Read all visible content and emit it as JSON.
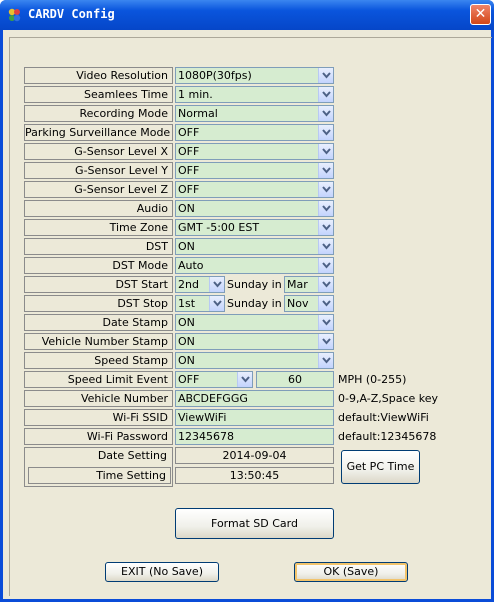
{
  "window": {
    "title": "CARDV Config",
    "close_glyph": "✕"
  },
  "settings": [
    {
      "label": "Video Resolution",
      "value": "1080P(30fps)"
    },
    {
      "label": "Seamlees Time",
      "value": "1 min."
    },
    {
      "label": "Recording Mode",
      "value": "Normal"
    },
    {
      "label": "Parking Surveillance Mode",
      "value": "OFF"
    },
    {
      "label": "G-Sensor Level X",
      "value": "OFF"
    },
    {
      "label": "G-Sensor Level Y",
      "value": "OFF"
    },
    {
      "label": "G-Sensor Level Z",
      "value": "OFF"
    },
    {
      "label": "Audio",
      "value": "ON"
    },
    {
      "label": "Time Zone",
      "value": "GMT -5:00 EST"
    },
    {
      "label": "DST",
      "value": "ON"
    },
    {
      "label": "DST Mode",
      "value": "Auto"
    }
  ],
  "dst_start": {
    "label": "DST Start",
    "week": "2nd",
    "middle": "Sunday in",
    "month": "Mar"
  },
  "dst_stop": {
    "label": "DST Stop",
    "week": "1st",
    "middle": "Sunday in",
    "month": "Nov"
  },
  "stamps": [
    {
      "label": "Date Stamp",
      "value": "ON"
    },
    {
      "label": "Vehicle Number Stamp",
      "value": "ON"
    },
    {
      "label": "Speed Stamp",
      "value": "ON"
    }
  ],
  "speed_limit": {
    "label": "Speed Limit Event",
    "value": "OFF",
    "limit": "60",
    "hint": "MPH (0-255)"
  },
  "vehicle_number": {
    "label": "Vehicle Number",
    "value": "ABCDEFGGG",
    "hint": "0-9,A-Z,Space key"
  },
  "wifi_ssid": {
    "label": "Wi-Fi SSID",
    "value": "ViewWiFi",
    "hint": "default:ViewWiFi"
  },
  "wifi_password": {
    "label": "Wi-Fi Password",
    "value": "12345678",
    "hint": "default:12345678"
  },
  "date_setting": {
    "label": "Date Setting",
    "value": "2014-09-04"
  },
  "time_setting": {
    "label": "Time Setting",
    "value": "13:50:45"
  },
  "buttons": {
    "get_pc_time": "Get PC Time",
    "format_sd": "Format SD Card",
    "exit": "EXIT (No Save)",
    "ok": "OK (Save)"
  },
  "colors": {
    "field_bg": "#d6ecd0",
    "title_bar": "#0a55dd",
    "dialog_bg": "#ece9d8",
    "close_button": "#d24617"
  }
}
